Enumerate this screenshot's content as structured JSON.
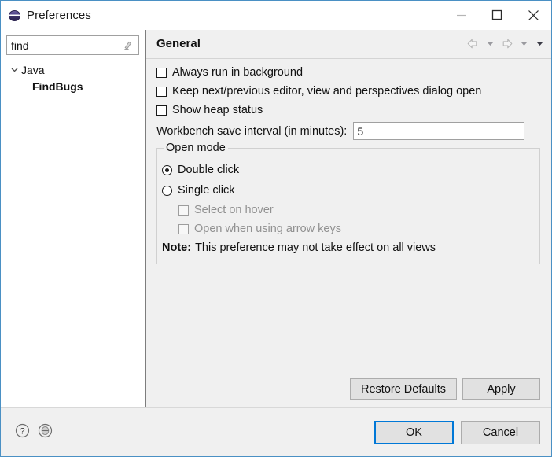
{
  "window": {
    "title": "Preferences",
    "icon": "preferences-icon",
    "controls": {
      "minimize": "minimize-icon",
      "maximize": "maximize-icon",
      "close": "close-icon"
    }
  },
  "sidebar": {
    "filter": {
      "value": "find",
      "placeholder": "type filter text",
      "clear_icon": "clear-filter-icon"
    },
    "tree": [
      {
        "label": "Java",
        "expanded": true,
        "twisty": "chevron-down-icon",
        "bold": false
      },
      {
        "label": "FindBugs",
        "expanded": false,
        "twisty": "",
        "bold": true
      }
    ]
  },
  "page": {
    "title": "General",
    "nav": {
      "back_icon": "arrow-left-icon",
      "back_menu_icon": "chevron-down-icon",
      "forward_icon": "arrow-right-icon",
      "forward_menu_icon": "chevron-down-icon",
      "view_menu_icon": "chevron-down-filled-icon"
    },
    "checkboxes": [
      {
        "label": "Always run in background",
        "checked": false,
        "enabled": true
      },
      {
        "label": "Keep next/previous editor, view and perspectives dialog open",
        "checked": false,
        "enabled": true
      },
      {
        "label": "Show heap status",
        "checked": false,
        "enabled": true
      }
    ],
    "save_interval": {
      "label": "Workbench save interval (in minutes):",
      "value": "5",
      "placeholder": ""
    },
    "open_mode": {
      "legend": "Open mode",
      "radios": [
        {
          "label": "Double click",
          "selected": true
        },
        {
          "label": "Single click",
          "selected": false
        }
      ],
      "sub_checkboxes": [
        {
          "label": "Select on hover",
          "checked": false,
          "enabled": false
        },
        {
          "label": "Open when using arrow keys",
          "checked": false,
          "enabled": false
        }
      ],
      "note_label": "Note:",
      "note_text": "This preference may not take effect on all views"
    },
    "buttons": {
      "restore_defaults": "Restore Defaults",
      "apply": "Apply"
    }
  },
  "footer": {
    "help_icon": "help-icon",
    "secondary_icon": "preferences-shortcut-icon",
    "ok": "OK",
    "cancel": "Cancel"
  },
  "colors": {
    "window_border": "#4a90c4",
    "panel_background": "#f0f0f0",
    "tree_background": "#ffffff",
    "focus_accent": "#0078d7",
    "disabled_text": "#919191"
  }
}
